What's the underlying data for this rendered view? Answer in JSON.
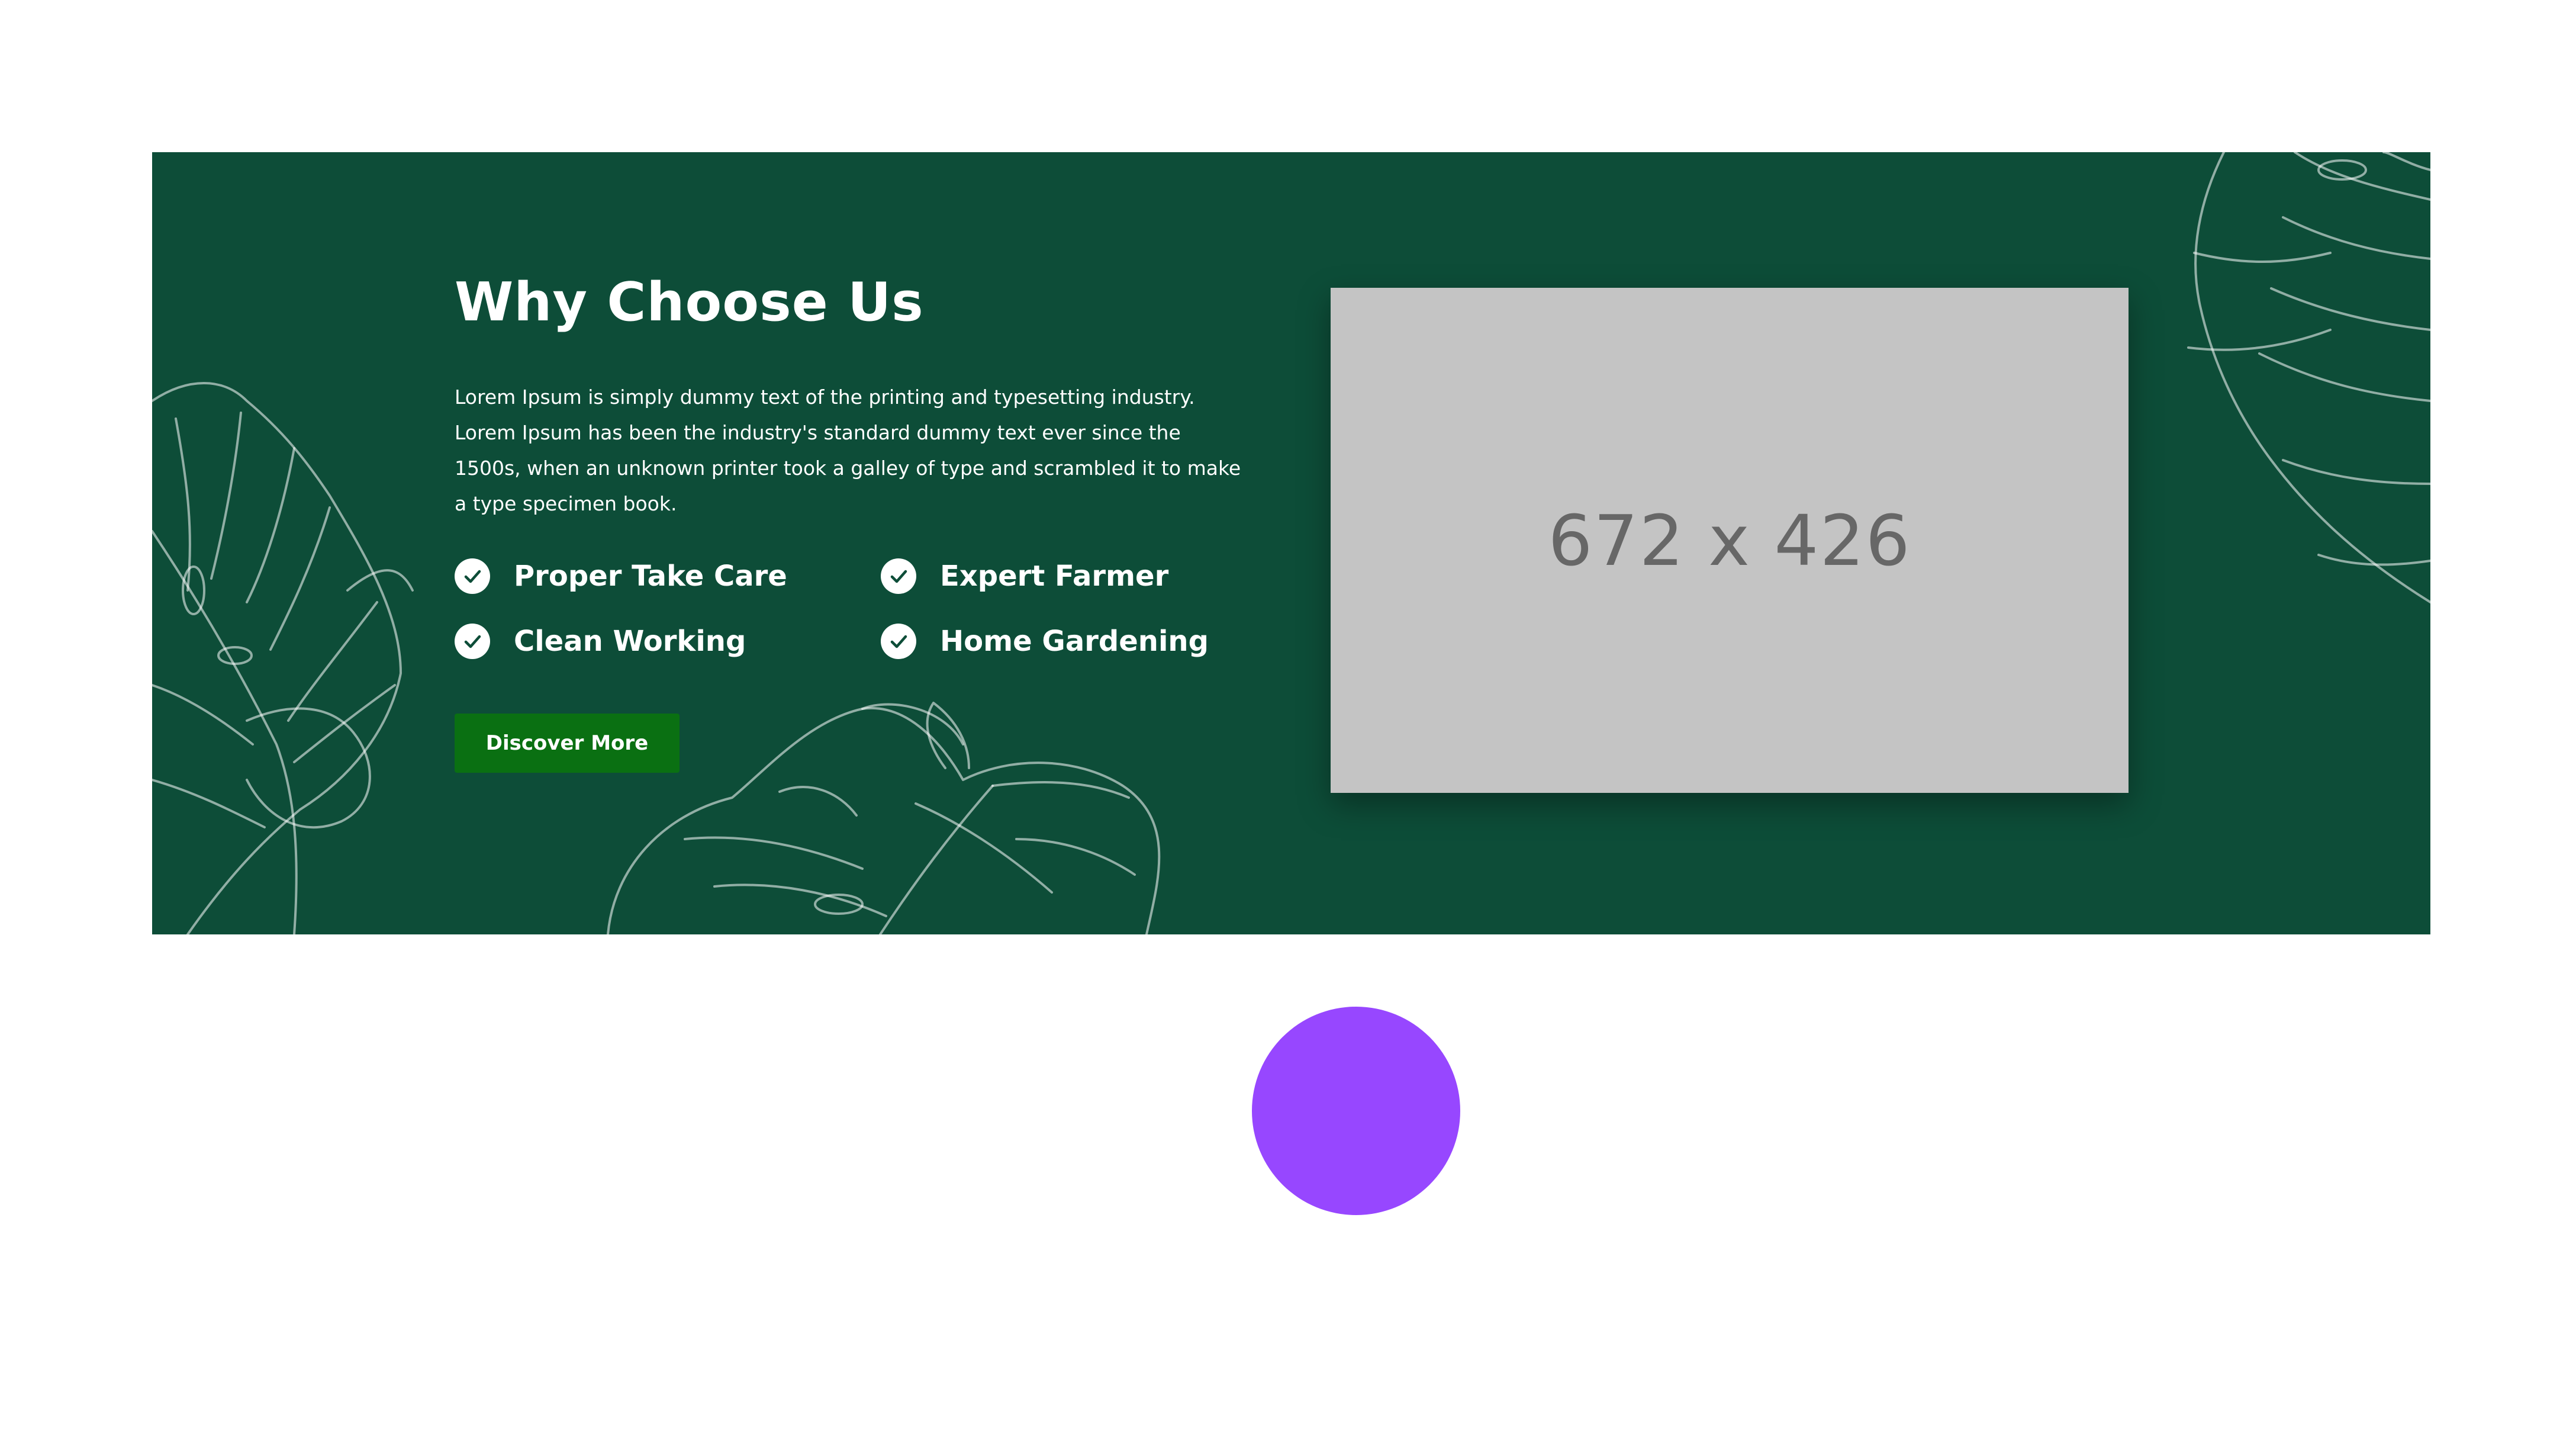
{
  "section": {
    "title": "Why Choose Us",
    "description": "Lorem Ipsum is simply dummy text of the printing and typesetting industry. Lorem Ipsum has been the industry's standard dummy text ever since the 1500s, when an unknown printer took a galley of type and scrambled it to make a type specimen book.",
    "features": [
      {
        "label": "Proper Take Care",
        "icon": "check-circle-icon"
      },
      {
        "label": "Expert Farmer",
        "icon": "check-circle-icon"
      },
      {
        "label": "Clean Working",
        "icon": "check-circle-icon"
      },
      {
        "label": "Home Gardening",
        "icon": "check-circle-icon"
      }
    ],
    "button_label": "Discover More",
    "image_placeholder_label": "672 x 426",
    "decoration_icon": "monstera-leaf-outline"
  },
  "colors": {
    "background": "#0d4d38",
    "button": "#0a7012",
    "placeholder": "#c4c4c4",
    "accent_circle": "#9747ff"
  }
}
